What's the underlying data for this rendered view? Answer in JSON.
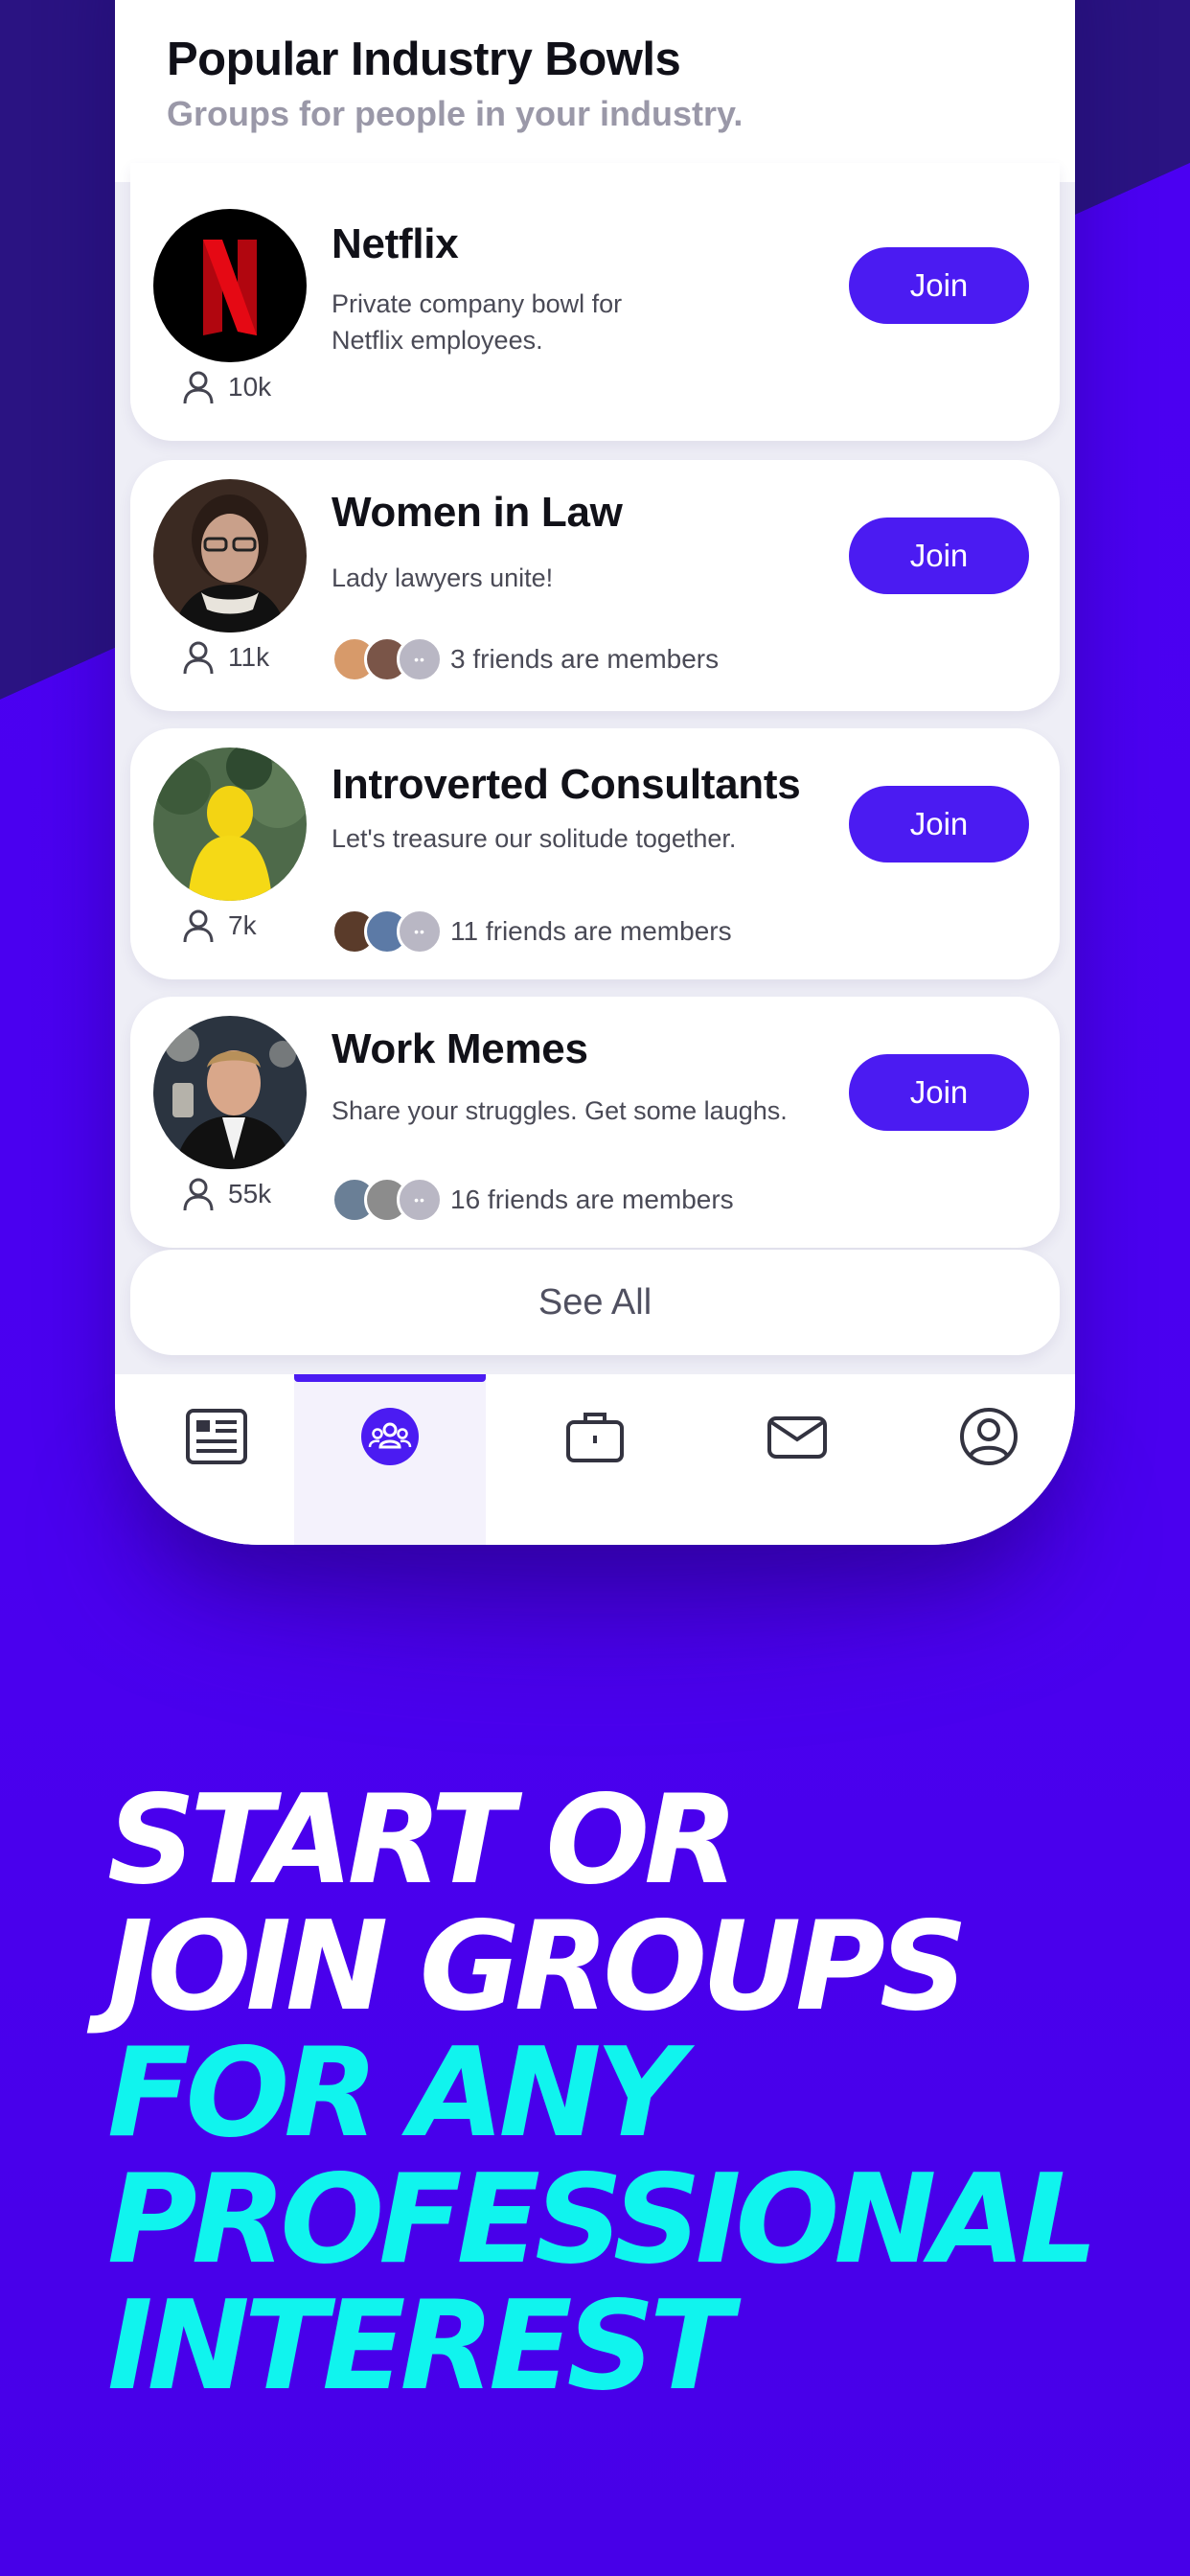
{
  "section": {
    "title": "Popular Industry Bowls",
    "subtitle": "Groups for people in your industry."
  },
  "groups": [
    {
      "name": "Netflix",
      "description": "Private company bowl for Netflix employees.",
      "members": "10k",
      "join_label": "Join",
      "friends_text": ""
    },
    {
      "name": "Women in Law",
      "description": "Lady lawyers unite!",
      "members": "11k",
      "join_label": "Join",
      "friends_text": "3 friends are members"
    },
    {
      "name": "Introverted Consultants",
      "description": "Let's treasure our solitude together.",
      "members": "7k",
      "join_label": "Join",
      "friends_text": "11 friends are members"
    },
    {
      "name": "Work Memes",
      "description": "Share your struggles. Get some laughs.",
      "members": "55k",
      "join_label": "Join",
      "friends_text": "16 friends are members"
    }
  ],
  "see_all_label": "See All",
  "tabbar": {
    "items": [
      "feed-icon",
      "groups-icon",
      "jobs-icon",
      "messages-icon",
      "profile-icon"
    ],
    "active_index": 1
  },
  "headline": {
    "line1": "START OR",
    "line2": "JOIN GROUPS",
    "line3": "FOR ANY",
    "line4": "PROFESSIONAL",
    "line5": "INTEREST"
  },
  "colors": {
    "accent": "#4b1bf2",
    "background": "#4a00f0",
    "highlight": "#10f4ee"
  }
}
